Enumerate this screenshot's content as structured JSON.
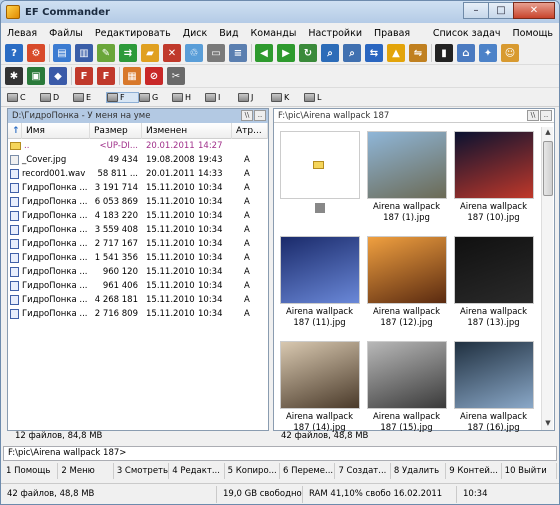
{
  "window": {
    "title": "EF Commander",
    "minimize": "–",
    "maximize": "□",
    "close": "✕"
  },
  "menu": {
    "left": [
      "Левая",
      "Файлы",
      "Редактировать",
      "Диск",
      "Вид",
      "Команды",
      "Настройки",
      "Правая"
    ],
    "right": [
      "Список задач",
      "Помощь"
    ]
  },
  "toolbar1": [
    {
      "icon": "help-icon",
      "color": "#2a6cc4",
      "glyph": "?"
    },
    {
      "icon": "settings-icon",
      "color": "#d84a2a",
      "glyph": "⚙"
    },
    {
      "icon": "new-file-icon",
      "color": "#3b7bd1",
      "glyph": "▤"
    },
    {
      "icon": "book-icon",
      "color": "#3a5ea8",
      "glyph": "▥"
    },
    {
      "icon": "edit-icon",
      "color": "#6aa63a",
      "glyph": "✎"
    },
    {
      "icon": "copy-icon",
      "color": "#2d9a3a",
      "glyph": "⇉"
    },
    {
      "icon": "new-folder-icon",
      "color": "#e0a020",
      "glyph": "▰"
    },
    {
      "icon": "delete-icon",
      "color": "#c0392b",
      "glyph": "✕"
    },
    {
      "icon": "recycle-icon",
      "color": "#5a9ed8",
      "glyph": "♲"
    },
    {
      "icon": "print-icon",
      "color": "#7a7a7a",
      "glyph": "▭"
    },
    {
      "icon": "properties-icon",
      "color": "#5b7fb0",
      "glyph": "≡"
    },
    {
      "icon": "back-icon",
      "color": "#2e9a2e",
      "glyph": "◀"
    },
    {
      "icon": "forward-icon",
      "color": "#2e9a2e",
      "glyph": "▶"
    },
    {
      "icon": "refresh-icon",
      "color": "#3a8a3a",
      "glyph": "↻"
    },
    {
      "icon": "find-icon",
      "color": "#2c6cb8",
      "glyph": "⌕"
    },
    {
      "icon": "find-file-icon",
      "color": "#4070b0",
      "glyph": "⌕"
    },
    {
      "icon": "sync-icon",
      "color": "#2a66c0",
      "glyph": "⇆"
    },
    {
      "icon": "warning-icon",
      "color": "#e3a40a",
      "glyph": "▲"
    },
    {
      "icon": "compare-icon",
      "color": "#c08020",
      "glyph": "⇋"
    },
    {
      "icon": "terminal-icon",
      "color": "#222222",
      "glyph": "▮"
    },
    {
      "icon": "network-icon",
      "color": "#4a7ac0",
      "glyph": "⌂"
    },
    {
      "icon": "tools-icon",
      "color": "#4c82c8",
      "glyph": "✦"
    },
    {
      "icon": "user-icon",
      "color": "#d89a30",
      "glyph": "☺"
    }
  ],
  "toolbar2": [
    {
      "icon": "network-drive-icon",
      "color": "#333333",
      "glyph": "✱"
    },
    {
      "icon": "monitor-icon",
      "color": "#2a7a3a",
      "glyph": "▣"
    },
    {
      "icon": "cube-icon",
      "color": "#3a5aa8",
      "glyph": "◆"
    },
    {
      "icon": "ftp-connect-icon",
      "color": "#c0392b",
      "glyph": "F"
    },
    {
      "icon": "ftp-disconnect-icon",
      "color": "#c0392b",
      "glyph": "F"
    },
    {
      "icon": "pack-icon",
      "color": "#d8782a",
      "glyph": "▦"
    },
    {
      "icon": "stop-icon",
      "color": "#c82828",
      "glyph": "⊘"
    },
    {
      "icon": "tools-wrench-icon",
      "color": "#6a6a6a",
      "glyph": "✂"
    }
  ],
  "drives": [
    "C",
    "D",
    "E",
    "F",
    "G",
    "H",
    "I",
    "J",
    "K",
    "L"
  ],
  "active_drive": "F",
  "left_panel": {
    "path": "D:\\ГидроПонка - У меня на уме",
    "columns": {
      "name": "Имя",
      "size": "Размер",
      "date": "Изменен",
      "attr": "Атр..."
    },
    "files": [
      {
        "name": "..",
        "size": "<UP-DI...",
        "date": "20.01.2011",
        "time": "14:27",
        "attr": "",
        "type": "updir"
      },
      {
        "name": "_Cover.jpg",
        "size": "49 434",
        "date": "19.08.2008",
        "time": "19:43",
        "attr": "A",
        "type": "jpg"
      },
      {
        "name": "record001.wav",
        "size": "58 811 ...",
        "date": "20.01.2011",
        "time": "14:33",
        "attr": "A",
        "type": "wav"
      },
      {
        "name": "ГидроПонка ...",
        "size": "3 191 714",
        "date": "15.11.2010",
        "time": "10:34",
        "attr": "A",
        "type": "wav"
      },
      {
        "name": "ГидроПонка ...",
        "size": "6 053 869",
        "date": "15.11.2010",
        "time": "10:34",
        "attr": "A",
        "type": "wav"
      },
      {
        "name": "ГидроПонка ...",
        "size": "4 183 220",
        "date": "15.11.2010",
        "time": "10:34",
        "attr": "A",
        "type": "wav"
      },
      {
        "name": "ГидроПонка ...",
        "size": "3 559 408",
        "date": "15.11.2010",
        "time": "10:34",
        "attr": "A",
        "type": "wav"
      },
      {
        "name": "ГидроПонка ...",
        "size": "2 717 167",
        "date": "15.11.2010",
        "time": "10:34",
        "attr": "A",
        "type": "wav"
      },
      {
        "name": "ГидроПонка ...",
        "size": "1 541 356",
        "date": "15.11.2010",
        "time": "10:34",
        "attr": "A",
        "type": "wav"
      },
      {
        "name": "ГидроПонка ...",
        "size": "960 120",
        "date": "15.11.2010",
        "time": "10:34",
        "attr": "A",
        "type": "wav"
      },
      {
        "name": "ГидроПонка ...",
        "size": "961 406",
        "date": "15.11.2010",
        "time": "10:34",
        "attr": "A",
        "type": "wav"
      },
      {
        "name": "ГидроПонка ...",
        "size": "4 268 181",
        "date": "15.11.2010",
        "time": "10:34",
        "attr": "A",
        "type": "wav"
      },
      {
        "name": "ГидроПонка ...",
        "size": "2 716 809",
        "date": "15.11.2010",
        "time": "10:34",
        "attr": "A",
        "type": "wav"
      }
    ],
    "status": "12 файлов, 84,8 MB"
  },
  "right_panel": {
    "path": "F:\\pic\\Airena wallpack 187",
    "thumbs": [
      {
        "caption": "",
        "type": "updir",
        "colors": [
          "#ffffff",
          "#ffffff"
        ]
      },
      {
        "caption": "Airena wallpack 187 (1).jpg",
        "type": "img",
        "colors": [
          "#8fb6d8",
          "#6b6a55"
        ]
      },
      {
        "caption": "Airena wallpack 187 (10).jpg",
        "type": "img",
        "colors": [
          "#0a1230",
          "#c0382a"
        ]
      },
      {
        "caption": "Airena wallpack 187 (11).jpg",
        "type": "img",
        "colors": [
          "#1a2a6a",
          "#6a88d8"
        ]
      },
      {
        "caption": "Airena wallpack 187 (12).jpg",
        "type": "img",
        "colors": [
          "#f0a040",
          "#5a2a10"
        ]
      },
      {
        "caption": "Airena wallpack 187 (13).jpg",
        "type": "img",
        "colors": [
          "#101010",
          "#2a2a2a"
        ]
      },
      {
        "caption": "Airena wallpack 187 (14).jpg",
        "type": "img",
        "colors": [
          "#d8c8b0",
          "#4a3a2a"
        ]
      },
      {
        "caption": "Airena wallpack 187 (15).jpg",
        "type": "img",
        "colors": [
          "#b8b8b8",
          "#3a3a3a"
        ]
      },
      {
        "caption": "Airena wallpack 187 (16).jpg",
        "type": "img",
        "colors": [
          "#203040",
          "#8aa8c8"
        ]
      }
    ],
    "status": "42 файлов, 48,8 MB"
  },
  "cmdline": "F:\\pic\\Airena wallpack 187>",
  "fkeys": [
    "1 Помощь",
    "2 Меню",
    "3 Смотреть",
    "4 Редакт...",
    "5 Копиро...",
    "6 Переме...",
    "7 Создат...",
    "8 Удалить",
    "9 Контей...",
    "10 Выйти"
  ],
  "statusbar": {
    "selection": "42 файлов, 48,8 MB",
    "free": "19,0 GB свободно",
    "ram": "RAM 41,10% свобо 16.02.2011",
    "time": "10:34"
  }
}
